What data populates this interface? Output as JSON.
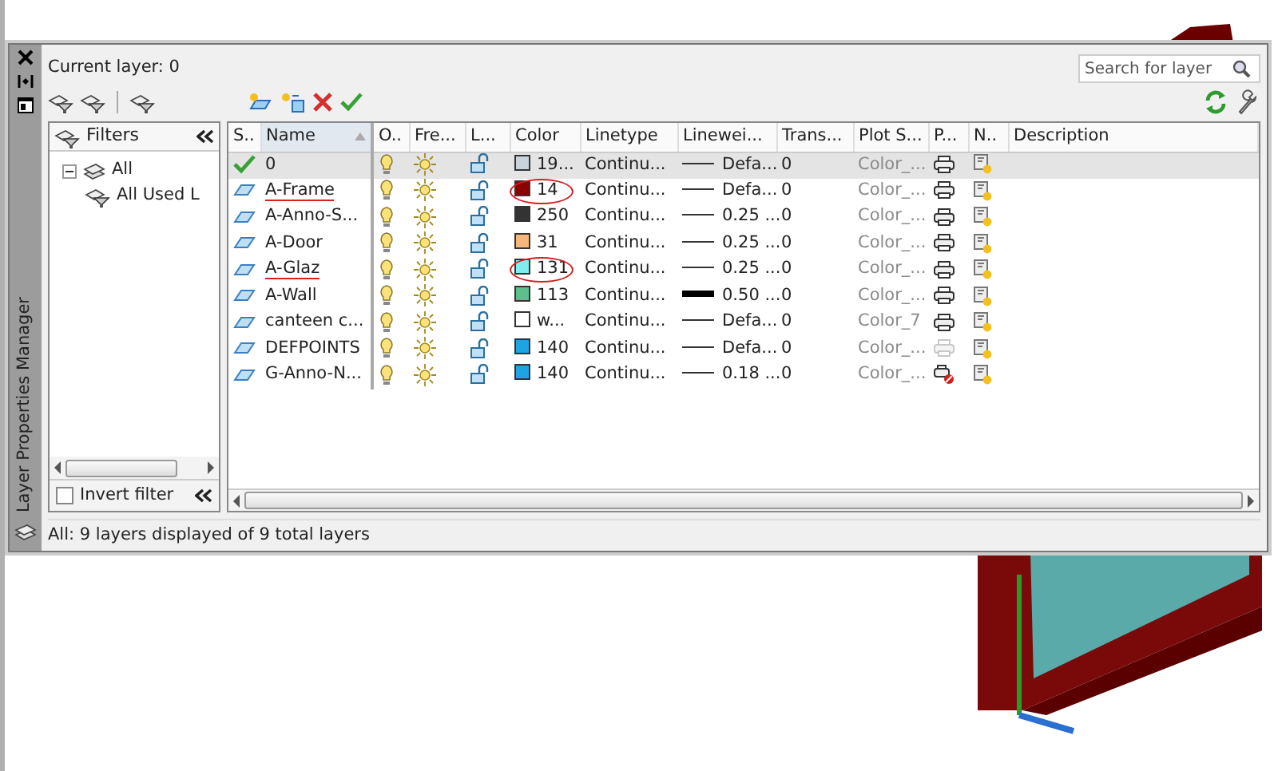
{
  "palette": {
    "title": "Layer Properties Manager",
    "current_layer": "Current layer: 0",
    "search": {
      "placeholder": "Search for layer"
    }
  },
  "filters": {
    "title": "Filters",
    "tree": [
      {
        "label": "All",
        "expanded": true,
        "children": [
          {
            "label": "All Used L"
          }
        ]
      }
    ],
    "invert_filter": {
      "label": "Invert filter",
      "checked": false
    }
  },
  "table": {
    "columns": [
      {
        "label": "S..",
        "sorted": false
      },
      {
        "label": "Name",
        "sorted": true
      },
      {
        "label": "O..",
        "sorted": false
      },
      {
        "label": "Fre...",
        "sorted": false
      },
      {
        "label": "L...",
        "sorted": false
      },
      {
        "label": "Color",
        "sorted": false
      },
      {
        "label": "Linetype",
        "sorted": false
      },
      {
        "label": "Linewei...",
        "sorted": false
      },
      {
        "label": "Trans...",
        "sorted": false
      },
      {
        "label": "Plot S...",
        "sorted": false
      },
      {
        "label": "P...",
        "sorted": false
      },
      {
        "label": "N..",
        "sorted": false
      },
      {
        "label": "Description",
        "sorted": false
      }
    ],
    "rows": [
      {
        "current": true,
        "selected": true,
        "name": "0",
        "underlined": false,
        "on": true,
        "frozen": false,
        "locked": false,
        "color": "#c9d3dc",
        "color_label": "19...",
        "circled": false,
        "linetype": "Continu...",
        "lineweight": "Defa...",
        "heavy": false,
        "transparency": "0",
        "plot_style": "Color_...",
        "plot": true,
        "dimmed": false
      },
      {
        "current": false,
        "selected": false,
        "name": "A-Frame",
        "underlined": true,
        "on": true,
        "frozen": false,
        "locked": false,
        "color": "#8b0000",
        "color_label": "14",
        "circled": true,
        "linetype": "Continu...",
        "lineweight": "Defa...",
        "heavy": false,
        "transparency": "0",
        "plot_style": "Color_...",
        "plot": true,
        "dimmed": false
      },
      {
        "current": false,
        "selected": false,
        "name": "A-Anno-S...",
        "underlined": false,
        "on": true,
        "frozen": false,
        "locked": false,
        "color": "#333333",
        "color_label": "250",
        "circled": false,
        "linetype": "Continu...",
        "lineweight": "0.25 ...",
        "heavy": false,
        "transparency": "0",
        "plot_style": "Color_...",
        "plot": true,
        "dimmed": false
      },
      {
        "current": false,
        "selected": false,
        "name": "A-Door",
        "underlined": false,
        "on": true,
        "frozen": false,
        "locked": false,
        "color": "#f5b77c",
        "color_label": "31",
        "circled": false,
        "linetype": "Continu...",
        "lineweight": "0.25 ...",
        "heavy": false,
        "transparency": "0",
        "plot_style": "Color_...",
        "plot": true,
        "dimmed": false
      },
      {
        "current": false,
        "selected": false,
        "name": "A-Glaz",
        "underlined": true,
        "on": true,
        "frozen": false,
        "locked": false,
        "color": "#80eef0",
        "color_label": "131",
        "circled": true,
        "linetype": "Continu...",
        "lineweight": "0.25 ...",
        "heavy": false,
        "transparency": "0",
        "plot_style": "Color_...",
        "plot": true,
        "dimmed": false
      },
      {
        "current": false,
        "selected": false,
        "name": "A-Wall",
        "underlined": false,
        "on": true,
        "frozen": false,
        "locked": false,
        "color": "#5cbf8c",
        "color_label": "113",
        "circled": false,
        "linetype": "Continu...",
        "lineweight": "0.50 ...",
        "heavy": true,
        "transparency": "0",
        "plot_style": "Color_...",
        "plot": true,
        "dimmed": false
      },
      {
        "current": false,
        "selected": false,
        "name": "canteen c...",
        "underlined": false,
        "on": true,
        "frozen": false,
        "locked": false,
        "color": "#ffffff",
        "color_label": "w...",
        "circled": false,
        "linetype": "Continu...",
        "lineweight": "Defa...",
        "heavy": false,
        "transparency": "0",
        "plot_style": "Color_7",
        "plot": true,
        "dimmed": false
      },
      {
        "current": false,
        "selected": false,
        "name": "DEFPOINTS",
        "underlined": false,
        "on": true,
        "frozen": false,
        "locked": false,
        "color": "#1ea3e3",
        "color_label": "140",
        "circled": false,
        "linetype": "Continu...",
        "lineweight": "Defa...",
        "heavy": false,
        "transparency": "0",
        "plot_style": "Color_...",
        "plot": true,
        "dimmed": true
      },
      {
        "current": false,
        "selected": false,
        "name": "G-Anno-N...",
        "underlined": false,
        "on": true,
        "frozen": false,
        "locked": false,
        "color": "#1ea3e3",
        "color_label": "140",
        "circled": false,
        "linetype": "Continu...",
        "lineweight": "0.18 ...",
        "heavy": false,
        "transparency": "0",
        "plot_style": "Color_...",
        "plot": false,
        "dimmed": false
      }
    ]
  },
  "status_bar": "All: 9 layers displayed of 9 total layers"
}
